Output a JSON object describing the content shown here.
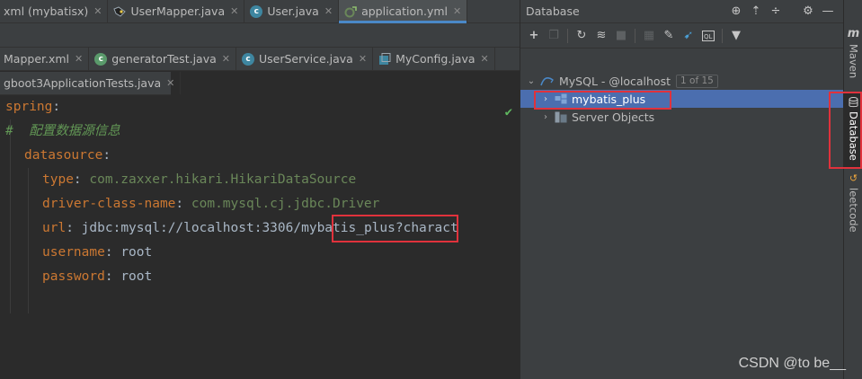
{
  "editor": {
    "tab_rows": [
      [
        {
          "label": "xml (mybatisx)",
          "icon": "xml-file-icon",
          "closable": true,
          "active": false
        },
        {
          "label": "UserMapper.java",
          "icon": "mapper-interface-icon",
          "closable": true,
          "active": false
        },
        {
          "label": "User.java",
          "icon": "java-class-icon",
          "closable": true,
          "active": false
        },
        {
          "label": "application.yml",
          "icon": "yaml-config-icon",
          "closable": true,
          "active": true
        }
      ],
      [
        {
          "label": "Mapper.xml",
          "icon": "xml-file-icon",
          "closable": true,
          "active": false
        },
        {
          "label": "generatorTest.java",
          "icon": "java-test-icon",
          "closable": true,
          "active": false
        },
        {
          "label": "UserService.java",
          "icon": "java-class-icon",
          "closable": true,
          "active": false
        },
        {
          "label": "MyConfig.java",
          "icon": "config-class-icon",
          "closable": true,
          "active": false
        }
      ],
      [
        {
          "label": "gboot3ApplicationTests.java",
          "icon": "",
          "closable": true,
          "active": false
        }
      ]
    ],
    "code_lines": [
      {
        "key": "spring",
        "sep": ":",
        "value": ""
      },
      {
        "comment": "#  配置数据源信息"
      },
      {
        "key": "datasource",
        "sep": ":",
        "value": ""
      },
      {
        "key": "type",
        "sep": ": ",
        "value": "com.zaxxer.hikari.HikariDataSource"
      },
      {
        "key": "driver-class-name",
        "sep": ": ",
        "value": "com.mysql.cj.jdbc.Driver"
      },
      {
        "key": "url",
        "sep": ": ",
        "value_a": "jdbc:mysql://localhost:3306",
        "value_b": "/mybatis_plus?",
        "value_c": "charact"
      },
      {
        "key": "username",
        "sep": ": ",
        "value": "root"
      },
      {
        "key": "password",
        "sep": ": ",
        "value": "root"
      }
    ],
    "inspection_status": "no-problems-check-icon"
  },
  "database_panel": {
    "title": "Database",
    "header_icons": [
      "add-target-icon",
      "expand-all-icon",
      "collapse-all-icon",
      "settings-gear-icon",
      "hide-panel-icon"
    ],
    "toolbar_icons": [
      "new-plus-icon",
      "duplicate-icon",
      "refresh-icon",
      "schema-sync-icon",
      "stop-icon",
      "table-editor-icon",
      "edit-pencil-icon",
      "jump-to-source-icon",
      "query-console-icon",
      "filter-icon"
    ],
    "tree": {
      "root": {
        "label": "MySQL - @localhost",
        "badge": "1 of 15",
        "icon": "mysql-datasource-icon",
        "expanded": true
      },
      "children": [
        {
          "label": "mybatis_plus",
          "icon": "schema-icon",
          "selected": true
        },
        {
          "label": "Server Objects",
          "icon": "server-objects-icon",
          "selected": false
        }
      ]
    }
  },
  "tool_stripe": [
    {
      "label": "Maven",
      "icon": "maven-icon",
      "active": false
    },
    {
      "label": "Database",
      "icon": "database-icon",
      "active": true
    },
    {
      "label": "leetcode",
      "icon": "leetcode-icon",
      "active": false
    }
  ],
  "watermark": "CSDN @to be__",
  "colors": {
    "accent": "#4a88c7",
    "selection": "#4b6eaf",
    "highlight_box": "#e0323c",
    "yaml_key": "#cc7832",
    "yaml_value": "#6a8759",
    "comment": "#629755"
  }
}
